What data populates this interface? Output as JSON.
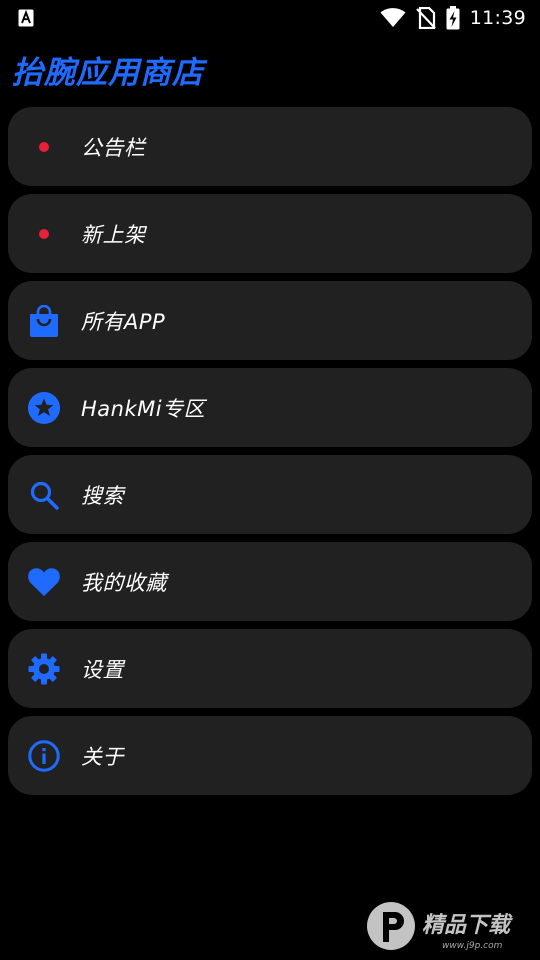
{
  "status_bar": {
    "time": "11:39",
    "icons": [
      "notification-a-icon",
      "wifi-icon",
      "no-sim-icon",
      "battery-charging-icon"
    ]
  },
  "app": {
    "title": "抬腕应用商店"
  },
  "colors": {
    "background": "#000000",
    "card": "#212121",
    "accent_blue": "#1f6bff",
    "dot_red": "#ea1f3a",
    "text": "#ffffff"
  },
  "menu": {
    "items": [
      {
        "label": "公告栏",
        "icon": "red-dot-icon"
      },
      {
        "label": "新上架",
        "icon": "red-dot-icon"
      },
      {
        "label": "所有APP",
        "icon": "shopping-bag-icon"
      },
      {
        "label": "HankMi专区",
        "icon": "star-circle-icon"
      },
      {
        "label": "搜索",
        "icon": "search-icon"
      },
      {
        "label": "我的收藏",
        "icon": "heart-icon"
      },
      {
        "label": "设置",
        "icon": "gear-icon"
      },
      {
        "label": "关于",
        "icon": "info-icon"
      }
    ]
  },
  "watermark": {
    "text": "精品下载",
    "sub": "www.j9p.com"
  }
}
